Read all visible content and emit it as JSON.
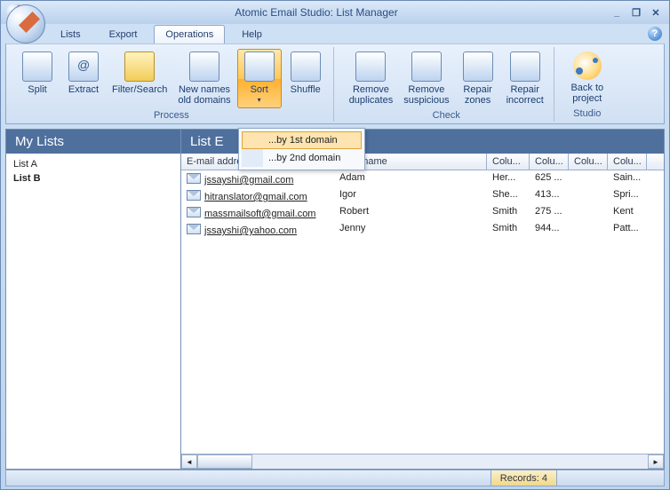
{
  "title": "Atomic Email Studio: List Manager",
  "window_controls": {
    "min": "_",
    "max": "❐",
    "close": "✕"
  },
  "menu": [
    "Lists",
    "Export",
    "Operations",
    "Help"
  ],
  "menu_active_index": 2,
  "ribbon": {
    "process": {
      "title": "Process",
      "buttons": [
        {
          "key": "split",
          "label": "Split"
        },
        {
          "key": "extract",
          "label": "Extract"
        },
        {
          "key": "filter",
          "label": "Filter/Search"
        },
        {
          "key": "newnames",
          "label": "New names\nold domains"
        },
        {
          "key": "sort",
          "label": "Sort",
          "dropdown": true,
          "active": true
        },
        {
          "key": "shuffle",
          "label": "Shuffle"
        }
      ]
    },
    "check": {
      "title": "Check",
      "buttons": [
        {
          "key": "rmdup",
          "label": "Remove\nduplicates"
        },
        {
          "key": "rmsus",
          "label": "Remove\nsuspicious"
        },
        {
          "key": "rzone",
          "label": "Repair\nzones"
        },
        {
          "key": "rinc",
          "label": "Repair\nincorrect"
        }
      ]
    },
    "studio": {
      "title": "Studio",
      "buttons": [
        {
          "key": "back",
          "label": "Back to\nproject"
        }
      ]
    }
  },
  "sort_menu": [
    "...by 1st domain",
    "...by 2nd domain"
  ],
  "sidebar": {
    "title": "My Lists",
    "items": [
      "List A",
      "List B"
    ],
    "selected_index": 1
  },
  "listpanel": {
    "title": "List E",
    "columns": [
      "E-mail address",
      "User name",
      "Colu...",
      "Colu...",
      "Colu...",
      "Colu..."
    ],
    "rows": [
      {
        "email": "jssayshi@gmail.com",
        "user": "Adam",
        "c2": "Her...",
        "c3": "625 ...",
        "c4": "",
        "c5": "Sain..."
      },
      {
        "email": "hitranslator@gmail.com",
        "user": "Igor",
        "c2": "She...",
        "c3": "413...",
        "c4": "",
        "c5": "Spri..."
      },
      {
        "email": "massmailsoft@gmail.com",
        "user": "Robert",
        "c2": "Smith",
        "c3": "275 ...",
        "c4": "",
        "c5": "Kent"
      },
      {
        "email": "jssayshi@yahoo.com",
        "user": "Jenny",
        "c2": "Smith",
        "c3": "944...",
        "c4": "",
        "c5": "Patt..."
      }
    ]
  },
  "status": {
    "records_label": "Records: 4"
  }
}
